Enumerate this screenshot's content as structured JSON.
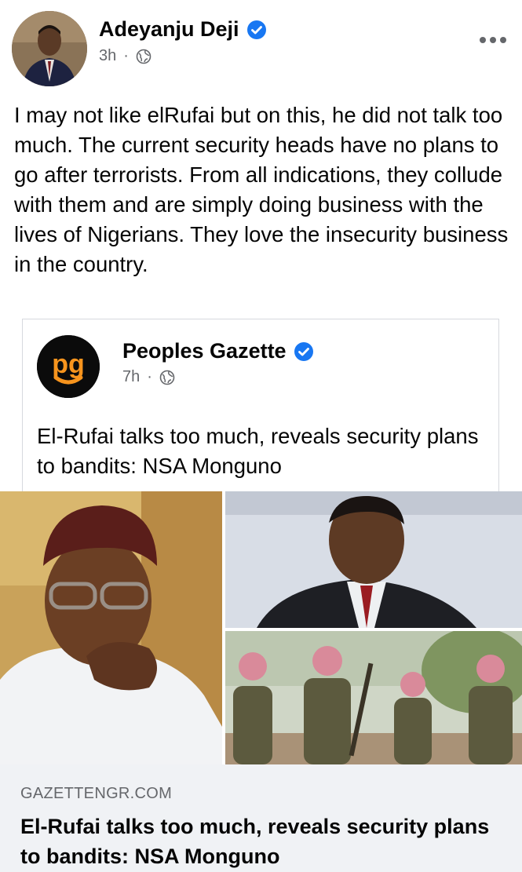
{
  "post": {
    "author": "Adeyanju Deji",
    "time": "3h",
    "separator": "·",
    "text": "I may not like elRufai but on this, he did not talk too much. The current security heads have no plans to go after terrorists. From all indications, they collude with them and are simply doing business with the lives of Nigerians. They love the insecurity business in the country."
  },
  "shared_post": {
    "author": "Peoples Gazette",
    "logo_text": "pg",
    "time": "7h",
    "separator": "·",
    "text": "El-Rufai talks too much, reveals security plans to bandits: NSA Monguno"
  },
  "link_preview": {
    "domain": "GAZETTENGR.COM",
    "title": "El-Rufai talks too much, reveals security plans to bandits: NSA Monguno"
  },
  "colors": {
    "verified_blue": "#1877f2",
    "meta_gray": "#65676b",
    "preview_bg": "#f0f2f5",
    "pg_orange": "#f7941d"
  },
  "icons": [
    "verified-badge-icon",
    "globe-icon",
    "more-options-icon"
  ]
}
